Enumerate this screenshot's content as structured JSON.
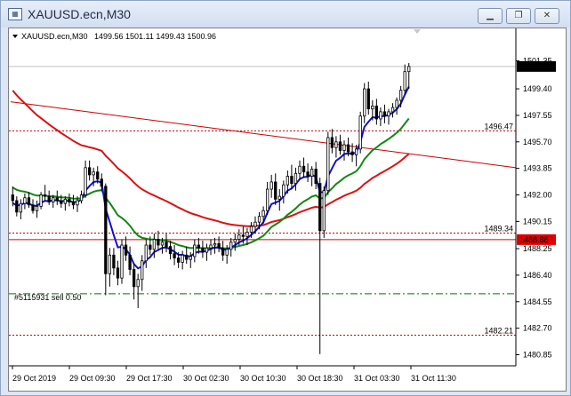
{
  "window": {
    "title": "XAUUSD.ecn,M30",
    "minimize_icon": "minimize-icon",
    "restore_icon": "restore-icon",
    "close_icon": "close-icon"
  },
  "chart_header": {
    "symbol": "XAUUSD.ecn,M30",
    "ohlc": "1499.56 1501.11 1499.43 1500.96"
  },
  "trade_label": "#5115931 sell 0.50",
  "chart_data": {
    "type": "candlestick",
    "symbol": "XAUUSD.ecn",
    "timeframe": "M30",
    "ylim": [
      1480.2,
      1502.5
    ],
    "y_ticks": [
      "1501.35",
      "1499.40",
      "1497.55",
      "1495.70",
      "1493.85",
      "1492.00",
      "1490.15",
      "1488.25",
      "1486.40",
      "1484.55",
      "1482.70",
      "1480.85"
    ],
    "x_ticks": [
      "29 Oct 2019",
      "29 Oct 09:30",
      "29 Oct 17:30",
      "30 Oct 02:30",
      "30 Oct 10:30",
      "30 Oct 18:30",
      "31 Oct 03:30",
      "31 Oct 11:30"
    ],
    "current_price": "1500.96",
    "levels": [
      {
        "price": 1496.47,
        "label": "1496.47",
        "style": "dotted",
        "color": "#cc0000"
      },
      {
        "price": 1489.34,
        "label": "1489.34",
        "style": "dotted",
        "color": "#cc0000"
      },
      {
        "price": 1488.88,
        "label": "1488.88",
        "style": "solid",
        "color": "#dd0000",
        "boxed": true
      },
      {
        "price": 1485.1,
        "label": "#5115931 sell 0.50",
        "style": "dashdot",
        "color": "#007700"
      },
      {
        "price": 1482.21,
        "label": "1482.21",
        "style": "dotted",
        "color": "#cc0000"
      }
    ],
    "trendline": {
      "from": [
        0,
        1498.5
      ],
      "to": [
        1,
        1493.9
      ],
      "color": "#cc0000"
    },
    "candles": [
      [
        1492.0,
        1492.6,
        1491.2,
        1491.6
      ],
      [
        1491.6,
        1491.9,
        1490.5,
        1490.8
      ],
      [
        1490.8,
        1491.7,
        1490.3,
        1491.4
      ],
      [
        1491.4,
        1492.1,
        1491.0,
        1491.8
      ],
      [
        1491.8,
        1492.2,
        1491.1,
        1491.3
      ],
      [
        1491.3,
        1491.7,
        1490.7,
        1490.9
      ],
      [
        1490.9,
        1491.6,
        1490.4,
        1491.2
      ],
      [
        1491.2,
        1492.2,
        1491.0,
        1492.0
      ],
      [
        1492.0,
        1492.7,
        1491.6,
        1491.9
      ],
      [
        1491.9,
        1492.3,
        1491.3,
        1491.5
      ],
      [
        1491.5,
        1492.0,
        1491.1,
        1491.8
      ],
      [
        1491.8,
        1492.3,
        1491.3,
        1491.6
      ],
      [
        1491.6,
        1492.0,
        1491.1,
        1491.4
      ],
      [
        1491.4,
        1491.9,
        1490.9,
        1491.7
      ],
      [
        1491.7,
        1492.1,
        1491.2,
        1491.5
      ],
      [
        1491.5,
        1492.0,
        1491.0,
        1491.3
      ],
      [
        1491.3,
        1491.9,
        1490.8,
        1491.6
      ],
      [
        1491.6,
        1492.3,
        1491.4,
        1492.0
      ],
      [
        1492.0,
        1494.4,
        1491.8,
        1493.9
      ],
      [
        1493.9,
        1494.4,
        1493.0,
        1493.4
      ],
      [
        1493.4,
        1493.9,
        1492.6,
        1493.6
      ],
      [
        1493.6,
        1494.0,
        1492.8,
        1493.1
      ],
      [
        1493.1,
        1493.5,
        1492.3,
        1492.6
      ],
      [
        1492.6,
        1492.8,
        1485.0,
        1486.5
      ],
      [
        1486.5,
        1488.3,
        1485.6,
        1487.8
      ],
      [
        1487.8,
        1488.3,
        1486.4,
        1486.9
      ],
      [
        1486.9,
        1487.4,
        1485.7,
        1486.2
      ],
      [
        1486.2,
        1488.9,
        1485.8,
        1488.5
      ],
      [
        1488.5,
        1489.1,
        1487.4,
        1487.8
      ],
      [
        1487.8,
        1488.4,
        1486.4,
        1486.8
      ],
      [
        1486.8,
        1487.2,
        1484.7,
        1485.6
      ],
      [
        1485.6,
        1486.5,
        1484.1,
        1486.1
      ],
      [
        1486.1,
        1487.8,
        1485.3,
        1487.4
      ],
      [
        1487.4,
        1488.9,
        1486.9,
        1488.5
      ],
      [
        1488.5,
        1489.1,
        1487.8,
        1488.2
      ],
      [
        1488.2,
        1489.3,
        1487.6,
        1488.9
      ],
      [
        1488.9,
        1489.5,
        1488.2,
        1488.5
      ],
      [
        1488.5,
        1489.0,
        1487.9,
        1488.7
      ],
      [
        1488.7,
        1489.3,
        1488.0,
        1488.4
      ],
      [
        1488.4,
        1488.8,
        1487.5,
        1487.9
      ],
      [
        1487.9,
        1488.5,
        1487.1,
        1487.6
      ],
      [
        1487.6,
        1488.0,
        1486.9,
        1487.3
      ],
      [
        1487.3,
        1488.1,
        1486.8,
        1487.8
      ],
      [
        1487.8,
        1488.4,
        1487.2,
        1487.5
      ],
      [
        1487.5,
        1488.0,
        1486.9,
        1487.7
      ],
      [
        1487.7,
        1488.9,
        1487.3,
        1488.5
      ],
      [
        1488.5,
        1489.0,
        1487.9,
        1488.3
      ],
      [
        1488.3,
        1488.8,
        1487.6,
        1488.0
      ],
      [
        1488.0,
        1488.6,
        1487.4,
        1488.3
      ],
      [
        1488.3,
        1488.9,
        1487.8,
        1488.5
      ],
      [
        1488.5,
        1489.0,
        1487.9,
        1488.6
      ],
      [
        1488.6,
        1489.1,
        1488.0,
        1488.3
      ],
      [
        1488.3,
        1488.8,
        1487.4,
        1487.8
      ],
      [
        1487.8,
        1488.5,
        1487.2,
        1488.2
      ],
      [
        1488.2,
        1489.0,
        1487.7,
        1488.7
      ],
      [
        1488.7,
        1489.3,
        1488.1,
        1488.9
      ],
      [
        1488.9,
        1489.6,
        1488.5,
        1489.2
      ],
      [
        1489.2,
        1489.8,
        1488.6,
        1489.1
      ],
      [
        1489.1,
        1489.7,
        1488.5,
        1489.4
      ],
      [
        1489.4,
        1490.1,
        1489.0,
        1489.8
      ],
      [
        1489.8,
        1490.5,
        1489.3,
        1490.1
      ],
      [
        1490.1,
        1490.8,
        1489.6,
        1490.5
      ],
      [
        1490.5,
        1491.2,
        1490.0,
        1490.9
      ],
      [
        1490.9,
        1492.9,
        1490.6,
        1492.4
      ],
      [
        1492.4,
        1493.4,
        1491.8,
        1492.9
      ],
      [
        1492.9,
        1493.5,
        1491.3,
        1491.7
      ],
      [
        1491.7,
        1492.4,
        1490.9,
        1491.9
      ],
      [
        1491.9,
        1493.0,
        1491.4,
        1492.7
      ],
      [
        1492.7,
        1493.7,
        1492.1,
        1493.3
      ],
      [
        1493.3,
        1494.1,
        1492.4,
        1492.8
      ],
      [
        1492.8,
        1493.9,
        1492.3,
        1493.5
      ],
      [
        1493.5,
        1494.4,
        1493.1,
        1494.0
      ],
      [
        1494.0,
        1494.6,
        1493.2,
        1493.6
      ],
      [
        1493.6,
        1494.2,
        1492.9,
        1493.3
      ],
      [
        1493.3,
        1494.0,
        1492.6,
        1493.8
      ],
      [
        1493.8,
        1494.3,
        1492.4,
        1492.8
      ],
      [
        1492.8,
        1493.2,
        1480.9,
        1489.5
      ],
      [
        1489.5,
        1492.6,
        1489.0,
        1492.3
      ],
      [
        1492.3,
        1496.4,
        1492.0,
        1496.0
      ],
      [
        1496.0,
        1496.6,
        1494.9,
        1495.3
      ],
      [
        1495.3,
        1496.1,
        1494.6,
        1495.7
      ],
      [
        1495.7,
        1496.2,
        1494.8,
        1495.1
      ],
      [
        1495.1,
        1495.8,
        1494.4,
        1495.5
      ],
      [
        1495.5,
        1496.0,
        1494.7,
        1495.0
      ],
      [
        1495.0,
        1495.6,
        1494.3,
        1494.8
      ],
      [
        1494.8,
        1495.5,
        1494.0,
        1495.2
      ],
      [
        1495.2,
        1497.8,
        1494.9,
        1497.5
      ],
      [
        1497.5,
        1499.8,
        1497.0,
        1499.4
      ],
      [
        1499.4,
        1499.9,
        1497.6,
        1498.0
      ],
      [
        1498.0,
        1498.6,
        1497.2,
        1498.2
      ],
      [
        1498.2,
        1498.7,
        1496.9,
        1497.3
      ],
      [
        1497.3,
        1498.1,
        1496.8,
        1497.8
      ],
      [
        1497.8,
        1498.3,
        1497.0,
        1497.5
      ],
      [
        1497.5,
        1498.0,
        1496.9,
        1497.8
      ],
      [
        1497.8,
        1498.4,
        1497.4,
        1498.1
      ],
      [
        1498.1,
        1498.8,
        1497.6,
        1498.6
      ],
      [
        1498.6,
        1499.6,
        1498.1,
        1499.3
      ],
      [
        1499.3,
        1501.1,
        1499.0,
        1500.6
      ],
      [
        1500.6,
        1501.2,
        1499.4,
        1500.96
      ]
    ],
    "series": [
      {
        "name": "",
        "color": "#dd1111",
        "period": 50
      },
      {
        "name": "",
        "color": "#118811",
        "period": 21
      },
      {
        "name": "",
        "color": "#1111cc",
        "period": 6
      }
    ]
  }
}
